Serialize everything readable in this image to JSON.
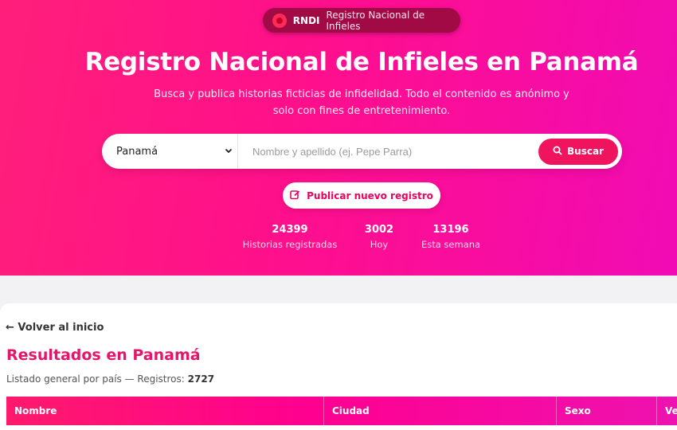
{
  "badge": {
    "code": "RNDI",
    "text": "Registro Nacional de Infieles"
  },
  "hero": {
    "title": "Registro Nacional de Infieles en Panamá",
    "subtitle": "Busca y publica historias ficticias de infidelidad. Todo el contenido es anónimo y solo con fines de entretenimiento."
  },
  "search": {
    "country": "Panamá",
    "placeholder": "Nombre y apellido (ej. Pepe Parra)",
    "button": "Buscar"
  },
  "publish_button": "Publicar nuevo registro",
  "stats": [
    {
      "value": "24399",
      "label": "Historias registradas"
    },
    {
      "value": "3002",
      "label": "Hoy"
    },
    {
      "value": "13196",
      "label": "Esta semana"
    }
  ],
  "results": {
    "back": "← Volver al inicio",
    "title": "Resultados en Panamá",
    "subtitle_prefix": "Listado general por país — Registros: ",
    "count": "2727"
  },
  "table": {
    "columns": [
      "Nombre",
      "Ciudad",
      "Sexo",
      "Ve"
    ]
  },
  "colors": {
    "accent": "#f0135e",
    "title_pink": "#e6156a"
  },
  "icons": {
    "badge": "circle-logo-icon",
    "search": "search-icon",
    "publish": "edit-icon",
    "select": "chevron-down-icon"
  }
}
